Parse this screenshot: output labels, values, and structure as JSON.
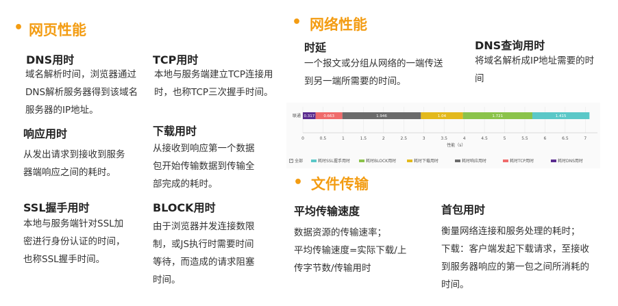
{
  "web_perf": {
    "title": "网页性能",
    "dns": {
      "term": "DNS用时",
      "lines": [
        "域名解析时间，浏览器通过",
        "DNS解析服务器得到该域名",
        "服务器的IP地址。"
      ]
    },
    "tcp": {
      "term": "TCP用时",
      "lines": [
        "本地与服务端建立TCP连接用",
        "时，也称TCP三次握手时间。"
      ]
    },
    "response": {
      "term": "响应用时",
      "lines": [
        "从发出请求到接收到服务",
        "器端响应之间的耗时。"
      ]
    },
    "download": {
      "term": "下载用时",
      "lines": [
        "从接收到响应第一个数据",
        "包开始传输数据到传输全",
        "部完成的耗时。"
      ]
    },
    "ssl": {
      "term": "SSL握手用时",
      "lines": [
        "本地与服务端针对SSL加",
        "密进行身份认证的时间，",
        "也称SSL握手时间。"
      ]
    },
    "block": {
      "term": "BLOCK用时",
      "lines": [
        "由于浏览器并发连接数限",
        "制，或JS执行时需要时间",
        "等待，而造成的请求阻塞",
        "时间。"
      ]
    }
  },
  "net_perf": {
    "title": "网络性能",
    "latency": {
      "term": "时延",
      "lines": [
        "一个报文或分组从网络的一端传送",
        "到另一端所需要的时间。"
      ]
    },
    "dns_query": {
      "term": "DNS查询用时",
      "lines": [
        "将域名解析成IP地址需要的时",
        "间"
      ]
    }
  },
  "file_transfer": {
    "title": "文件传输",
    "avg_speed": {
      "term": "平均传输速度",
      "lines": [
        "数据资源的传输速率；",
        "平均传输速度=实际下载/上",
        "传字节数/传输用时"
      ]
    },
    "first_packet": {
      "term": "首包用时",
      "lines": [
        "衡量网络连接和服务处理的耗时；",
        "下载：客户端发起下载请求，至接收",
        "到服务器响应的第一包之间所消耗的",
        "时间。"
      ]
    }
  },
  "chart_data": {
    "type": "bar",
    "orientation": "horizontal",
    "stacked": true,
    "categories": [
      "联通"
    ],
    "series": [
      {
        "name": "耗时DNS用时",
        "values": [
          0.317
        ],
        "color": "#5b2c8f"
      },
      {
        "name": "耗时TCP用时",
        "values": [
          0.663
        ],
        "color": "#ef6b6b"
      },
      {
        "name": "耗时响应用时",
        "values": [
          1.946
        ],
        "color": "#6b6b6b"
      },
      {
        "name": "耗时下载用时",
        "values": [
          1.04
        ],
        "color": "#e3b91c"
      },
      {
        "name": "耗时BLOCK用时",
        "values": [
          1.721
        ],
        "color": "#8bc34a"
      },
      {
        "name": "耗时SSL握手用时",
        "values": [
          1.415
        ],
        "color": "#5bc8c8"
      }
    ],
    "legend_order": [
      "耗时SSL握手用时",
      "耗时BLOCK用时",
      "耗时下载用时",
      "耗时响应用时",
      "耗时TCP用时",
      "耗时DNS用时"
    ],
    "legend_all": "全部",
    "xticks": [
      "0",
      "0.5",
      "1",
      "1.5",
      "2",
      "2.5",
      "3",
      "3.5",
      "4",
      "4.5",
      "5",
      "5.5",
      "6",
      "6.5",
      "7"
    ],
    "xlabel": "性能（s）",
    "xlim": [
      0,
      7.3
    ],
    "legend_position": "bottom",
    "grid": true
  }
}
